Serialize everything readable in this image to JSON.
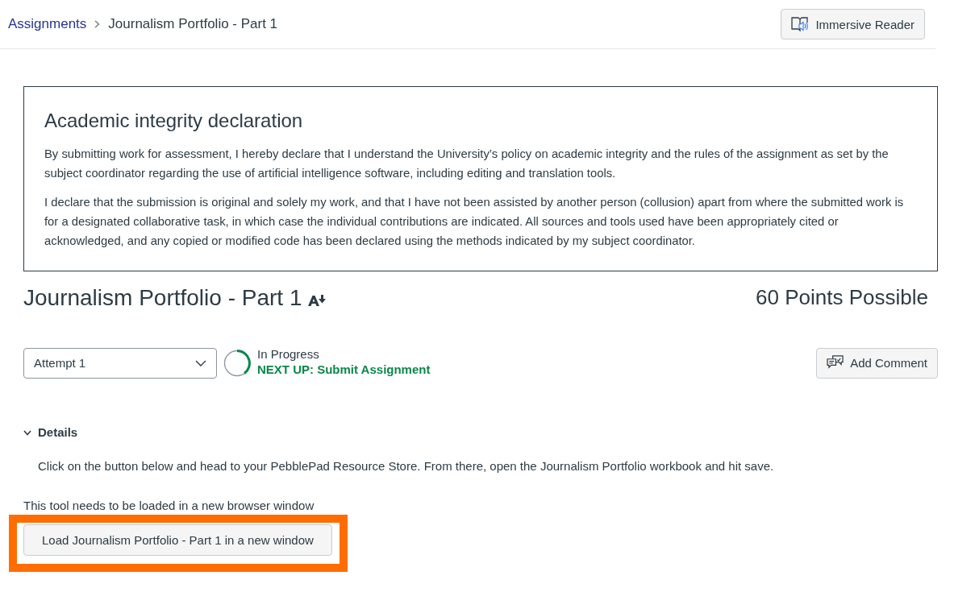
{
  "breadcrumb": [
    {
      "label": "Assignments",
      "kind": "link"
    },
    {
      "label": "Journalism Portfolio - Part 1",
      "kind": "current"
    }
  ],
  "immersive_reader_button": "Immersive Reader",
  "declaration": {
    "title": "Academic integrity declaration",
    "paragraphs": [
      "By submitting work for assessment, I hereby declare that I understand the University’s policy on academic integrity and the rules of the assignment as set by the subject coordinator regarding the use of artificial intelligence software, including editing and translation tools.",
      "I declare that the submission is original and solely my work, and that I have not been assisted by another person (collusion) apart from where the submitted work is for a designated collaborative task, in which case the individual contributions are indicated. All sources and tools used have been appropriately cited or acknowledged, and any copied or modified code has been declared using the methods indicated by my subject coordinator."
    ]
  },
  "assignment": {
    "title": "Journalism Portfolio - Part 1",
    "points": "60 Points Possible"
  },
  "attempt_select": {
    "value": "Attempt 1"
  },
  "progress": {
    "status": "In Progress",
    "next_step": "NEXT UP: Submit Assignment"
  },
  "add_comment_button": "Add Comment",
  "details": {
    "label": "Details",
    "expanded": true,
    "text": "Click on the button below and head to your PebblePad Resource Store. From there, open the Journalism Portfolio workbook and hit save."
  },
  "tool_notice": "This tool needs to be loaded in a new browser window",
  "launch_button": {
    "label": "Load Journalism Portfolio - Part 1 in a new window",
    "highlighted": true
  }
}
